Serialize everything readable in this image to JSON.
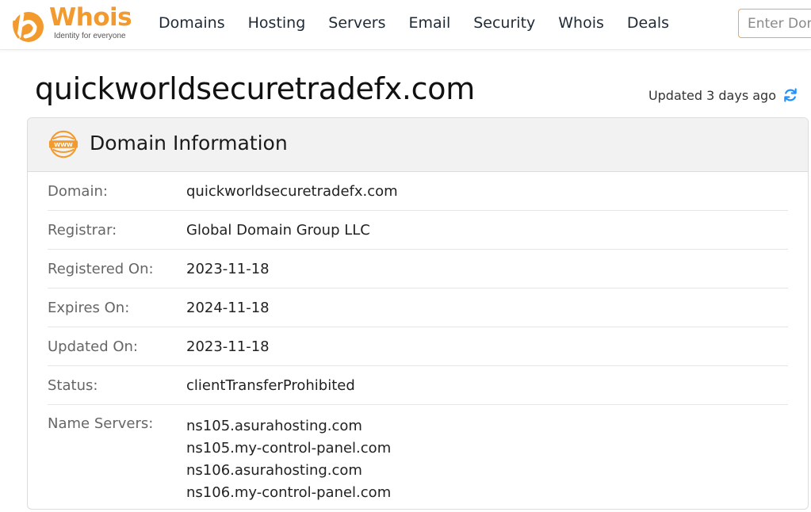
{
  "header": {
    "logo_word": "Whois",
    "logo_tagline": "Identity for everyone",
    "nav": [
      "Domains",
      "Hosting",
      "Servers",
      "Email",
      "Security",
      "Whois",
      "Deals"
    ],
    "search_placeholder": "Enter Domain"
  },
  "page": {
    "domain_title": "quickworldsecuretradefx.com",
    "updated_text": "Updated 3 days ago"
  },
  "card": {
    "title": "Domain Information",
    "icon": "www-icon",
    "rows": [
      {
        "label": "Domain:",
        "value": "quickworldsecuretradefx.com"
      },
      {
        "label": "Registrar:",
        "value": "Global Domain Group LLC"
      },
      {
        "label": "Registered On:",
        "value": "2023-11-18"
      },
      {
        "label": "Expires On:",
        "value": "2024-11-18"
      },
      {
        "label": "Updated On:",
        "value": "2023-11-18"
      },
      {
        "label": "Status:",
        "value": "clientTransferProhibited"
      }
    ],
    "name_servers_label": "Name Servers:",
    "name_servers": [
      "ns105.asurahosting.com",
      "ns105.my-control-panel.com",
      "ns106.asurahosting.com",
      "ns106.my-control-panel.com"
    ]
  },
  "colors": {
    "brand_orange": "#f29a2e",
    "refresh_blue": "#1e90ff"
  }
}
